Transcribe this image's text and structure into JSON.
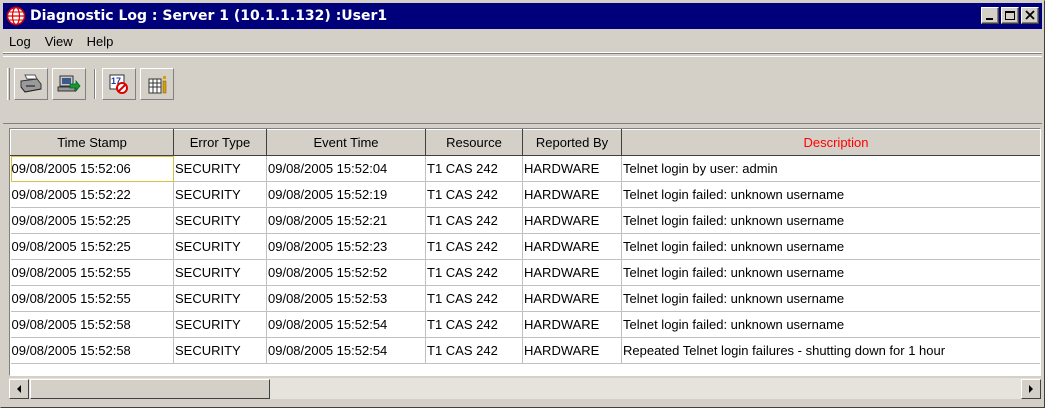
{
  "window": {
    "title": "Diagnostic Log : Server 1 (10.1.1.132) :User1",
    "icon": "globe-icon",
    "controls": [
      "minimize-icon",
      "maximize-icon",
      "close-icon"
    ]
  },
  "menu": [
    {
      "label": "Log"
    },
    {
      "label": "View"
    },
    {
      "label": "Help"
    }
  ],
  "toolbar": {
    "buttons": [
      {
        "icon": "printer-icon"
      },
      {
        "icon": "export-icon"
      },
      {
        "icon": "clear-log-icon"
      },
      {
        "icon": "statistics-icon"
      }
    ]
  },
  "table": {
    "columns": [
      "Time Stamp",
      "Error Type",
      "Event Time",
      "Resource",
      "Reported By",
      "Description"
    ],
    "highlight_column_color": "#ff0000",
    "rows": [
      [
        "09/08/2005 15:52:06",
        "SECURITY",
        "09/08/2005 15:52:04",
        "T1 CAS 242",
        "HARDWARE",
        "Telnet login by user: admin"
      ],
      [
        "09/08/2005 15:52:22",
        "SECURITY",
        "09/08/2005 15:52:19",
        "T1 CAS 242",
        "HARDWARE",
        "Telnet login failed: unknown username"
      ],
      [
        "09/08/2005 15:52:25",
        "SECURITY",
        "09/08/2005 15:52:21",
        "T1 CAS 242",
        "HARDWARE",
        "Telnet login failed: unknown username"
      ],
      [
        "09/08/2005 15:52:25",
        "SECURITY",
        "09/08/2005 15:52:23",
        "T1 CAS 242",
        "HARDWARE",
        "Telnet login failed: unknown username"
      ],
      [
        "09/08/2005 15:52:55",
        "SECURITY",
        "09/08/2005 15:52:52",
        "T1 CAS 242",
        "HARDWARE",
        "Telnet login failed: unknown username"
      ],
      [
        "09/08/2005 15:52:55",
        "SECURITY",
        "09/08/2005 15:52:53",
        "T1 CAS 242",
        "HARDWARE",
        "Telnet login failed: unknown username"
      ],
      [
        "09/08/2005 15:52:58",
        "SECURITY",
        "09/08/2005 15:52:54",
        "T1 CAS 242",
        "HARDWARE",
        "Telnet login failed: unknown username"
      ],
      [
        "09/08/2005 15:52:58",
        "SECURITY",
        "09/08/2005 15:52:54",
        "T1 CAS 242",
        "HARDWARE",
        "Repeated Telnet login failures - shutting down for 1 hour"
      ]
    ]
  },
  "scrollbar": {
    "left_icon": "arrow-left-icon",
    "right_icon": "arrow-right-icon"
  }
}
